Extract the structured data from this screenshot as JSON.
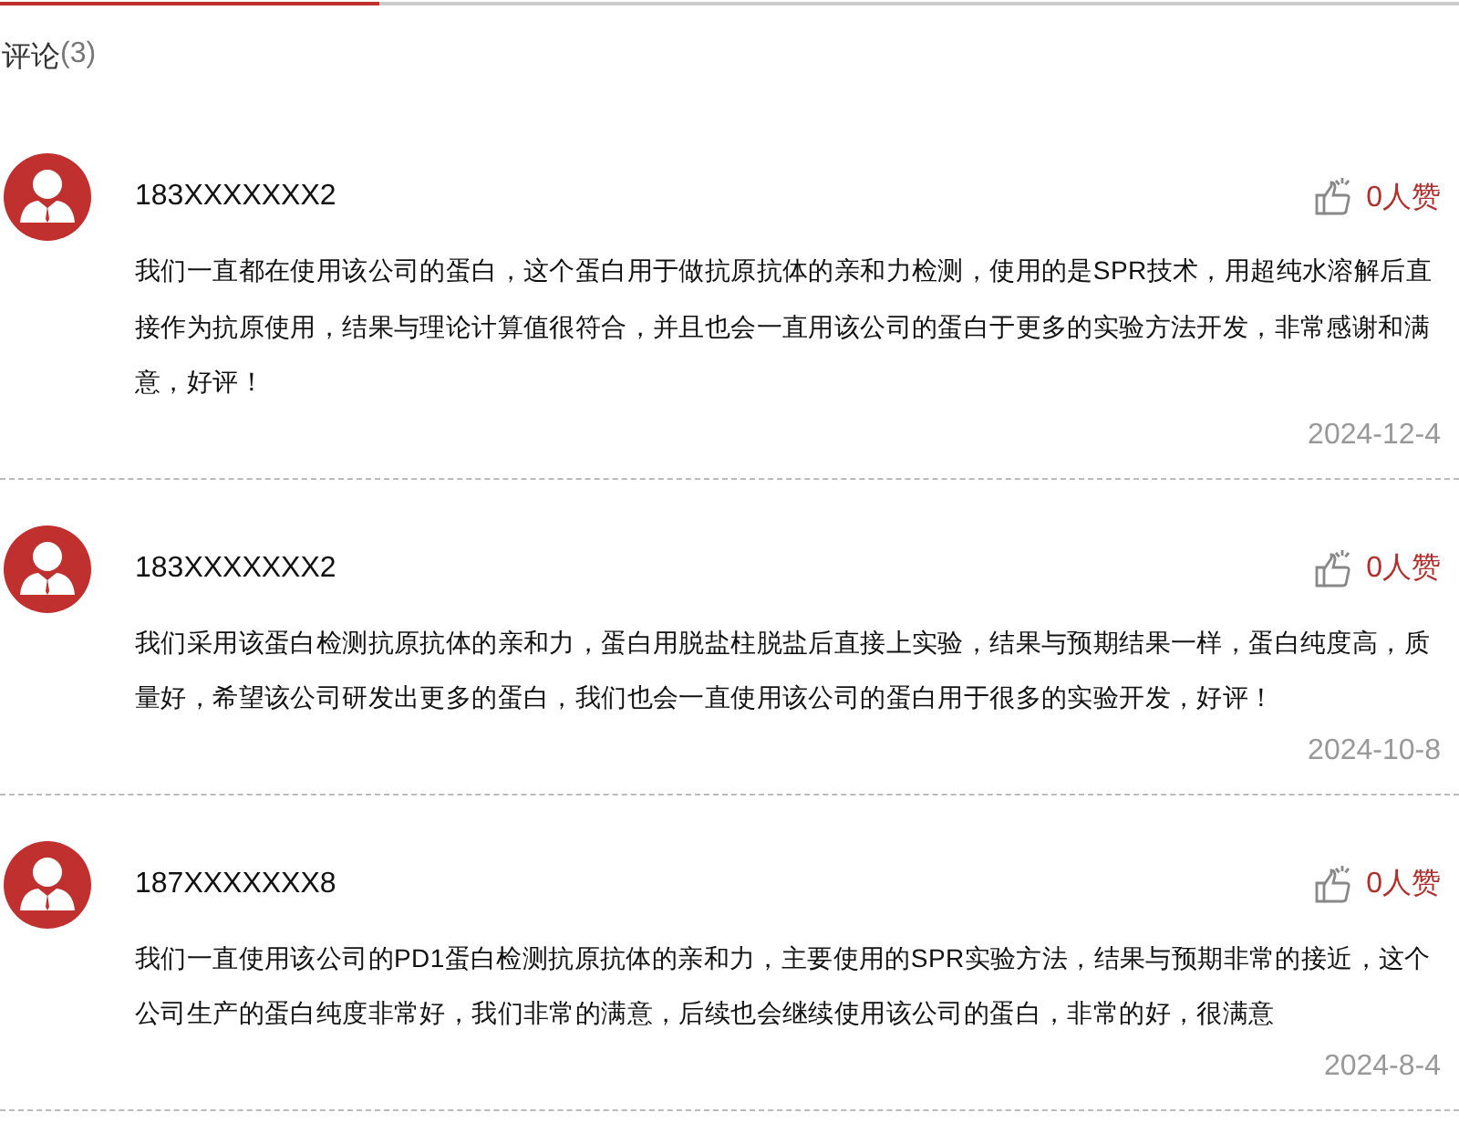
{
  "heading": {
    "label": "评论",
    "count": "(3)"
  },
  "comments": [
    {
      "user": "183XXXXXXX2",
      "likes": "0人赞",
      "text": "我们一直都在使用该公司的蛋白，这个蛋白用于做抗原抗体的亲和力检测，使用的是SPR技术，用超纯水溶解后直接作为抗原使用，结果与理论计算值很符合，并且也会一直用该公司的蛋白于更多的实验方法开发，非常感谢和满意，好评！",
      "date": "2024-12-4"
    },
    {
      "user": "183XXXXXXX2",
      "likes": "0人赞",
      "text": "我们采用该蛋白检测抗原抗体的亲和力，蛋白用脱盐柱脱盐后直接上实验，结果与预期结果一样，蛋白纯度高，质量好，希望该公司研发出更多的蛋白，我们也会一直使用该公司的蛋白用于很多的实验开发，好评！",
      "date": "2024-10-8"
    },
    {
      "user": "187XXXXXXX8",
      "likes": "0人赞",
      "text": "我们一直使用该公司的PD1蛋白检测抗原抗体的亲和力，主要使用的SPR实验方法，结果与预期非常的接近，这个公司生产的蛋白纯度非常好，我们非常的满意，后续也会继续使用该公司的蛋白，非常的好，很满意",
      "date": "2024-8-4"
    }
  ]
}
